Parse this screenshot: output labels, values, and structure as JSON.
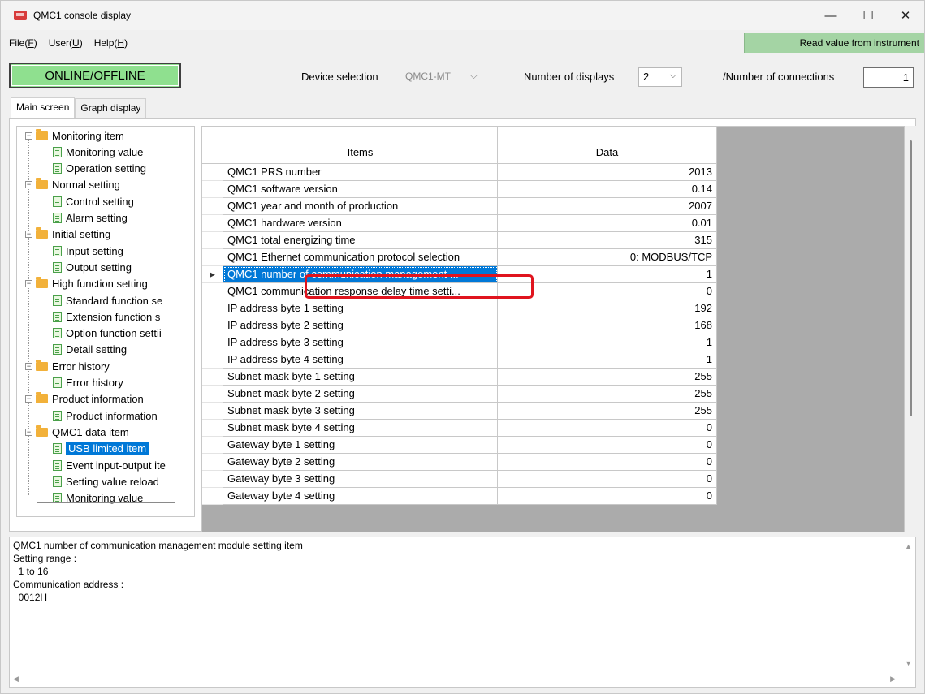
{
  "window": {
    "title": "QMC1 console display",
    "minimize": "—",
    "maximize": "☐",
    "close": "✕"
  },
  "menu": {
    "file": "File(",
    "file_key": "F",
    "user": "User(",
    "user_key": "U",
    "help": "Help(",
    "help_key": "H",
    "close_paren": ")",
    "read_value": "Read value from instrument"
  },
  "toolbar": {
    "online_offline": "ONLINE/OFFLINE",
    "device_selection_label": "Device selection",
    "device_selection_value": "QMC1-MT",
    "num_displays_label": "Number of displays",
    "num_displays_value": "2",
    "num_connections_label": "/Number of connections",
    "num_connections_value": "1"
  },
  "tabs": {
    "main": "Main screen",
    "graph": "Graph display"
  },
  "tree": {
    "groups": [
      {
        "label": "Monitoring item",
        "children": [
          "Monitoring value",
          "Operation setting"
        ]
      },
      {
        "label": "Normal setting",
        "children": [
          "Control setting",
          "Alarm setting"
        ]
      },
      {
        "label": "Initial setting",
        "children": [
          "Input setting",
          "Output setting"
        ]
      },
      {
        "label": "High function setting",
        "children": [
          "Standard function se",
          "Extension function s",
          "Option function settii",
          "Detail setting"
        ]
      },
      {
        "label": "Error history",
        "children": [
          "Error history"
        ]
      },
      {
        "label": "Product information",
        "children": [
          "Product information"
        ]
      },
      {
        "label": "QMC1 data item",
        "children": [
          "USB limited item",
          "Event input-output ite",
          "Setting value reload",
          "Monitoring value"
        ]
      }
    ],
    "selected": "USB limited item",
    "expander": "−"
  },
  "grid": {
    "headers": {
      "items": "Items",
      "data": "Data"
    },
    "row_pointer": "▶",
    "rows": [
      {
        "item": "QMC1 PRS number",
        "data": "2013"
      },
      {
        "item": "QMC1 software version",
        "data": "0.14"
      },
      {
        "item": "QMC1 year and month of production",
        "data": "2007"
      },
      {
        "item": "QMC1 hardware version",
        "data": "0.01"
      },
      {
        "item": "QMC1 total energizing time",
        "data": "315"
      },
      {
        "item": "QMC1 Ethernet communication protocol selection",
        "data": "0: MODBUS/TCP"
      },
      {
        "item": "QMC1 number of communication management ...",
        "data": "1"
      },
      {
        "item": "QMC1 communication response delay time setti...",
        "data": "0"
      },
      {
        "item": "IP address byte 1 setting",
        "data": "192"
      },
      {
        "item": "IP address byte 2 setting",
        "data": "168"
      },
      {
        "item": "IP address byte 3 setting",
        "data": "1"
      },
      {
        "item": "IP address byte 4 setting",
        "data": "1"
      },
      {
        "item": "Subnet mask byte 1 setting",
        "data": "255"
      },
      {
        "item": "Subnet mask byte 2 setting",
        "data": "255"
      },
      {
        "item": "Subnet mask byte 3 setting",
        "data": "255"
      },
      {
        "item": "Subnet mask byte 4 setting",
        "data": "0"
      },
      {
        "item": "Gateway byte 1 setting",
        "data": "0"
      },
      {
        "item": "Gateway byte 2 setting",
        "data": "0"
      },
      {
        "item": "Gateway byte 3 setting",
        "data": "0"
      },
      {
        "item": "Gateway byte 4 setting",
        "data": "0"
      }
    ],
    "selected_row": 6
  },
  "description": {
    "text": "QMC1 number of communication management module setting item\nSetting range :\n  1 to 16\nCommunication address :\n  0012H"
  },
  "colors": {
    "online_button": "#8fe08f",
    "read_value_bg": "#a4d4a4",
    "selection": "#0078d7",
    "highlight": "#e0141e",
    "folder": "#f2b13a"
  }
}
